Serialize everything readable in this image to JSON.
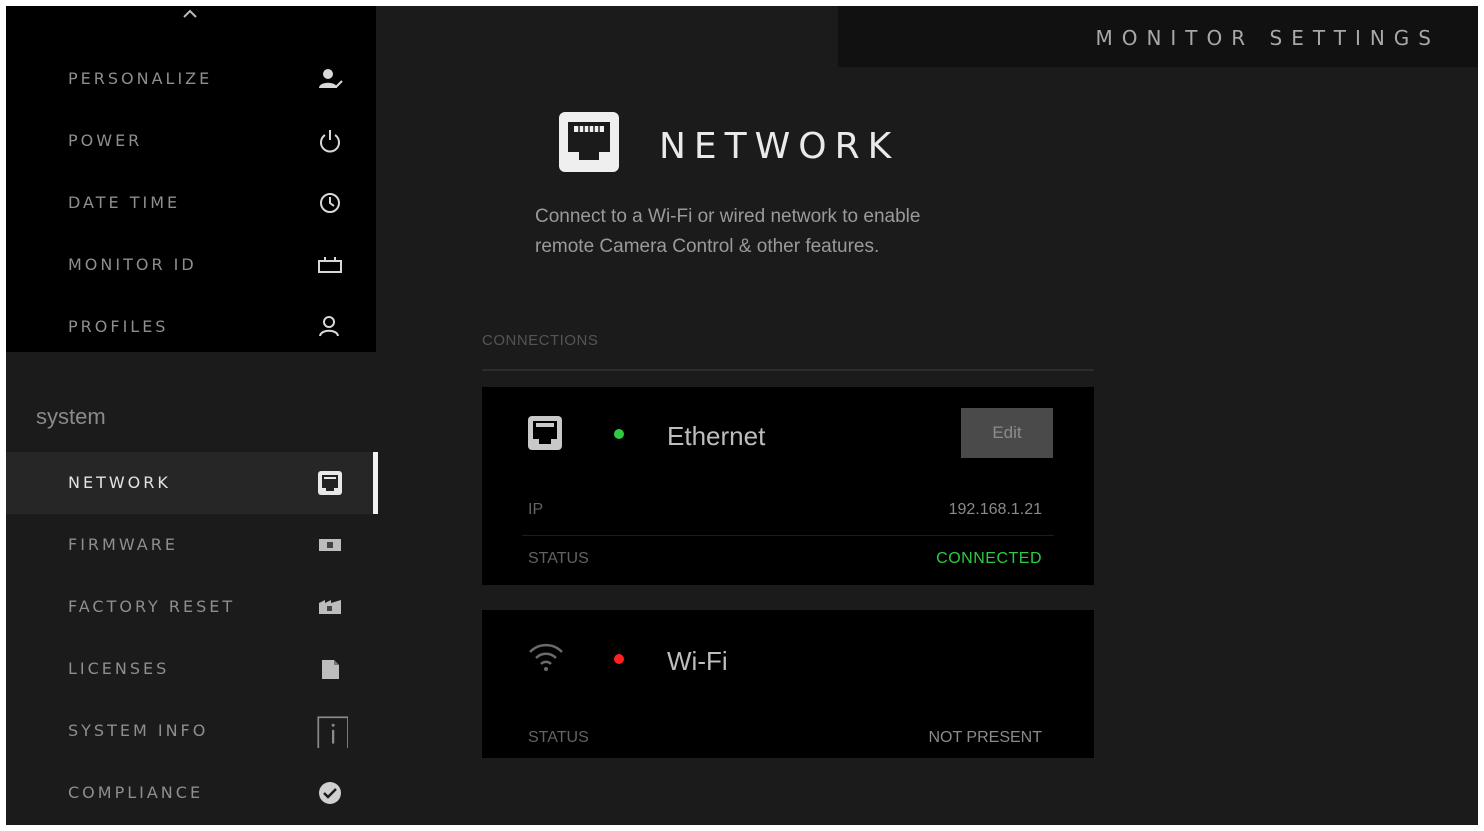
{
  "header": {
    "title": "MONITOR SETTINGS"
  },
  "sidebar": {
    "top_items": [
      {
        "label": "PERSONALIZE",
        "icon": "personalize-icon"
      },
      {
        "label": "POWER",
        "icon": "power-icon"
      },
      {
        "label": "DATE TIME",
        "icon": "clock-icon"
      },
      {
        "label": "MONITOR ID",
        "icon": "monitor-id-icon"
      },
      {
        "label": "PROFILES",
        "icon": "profiles-icon"
      }
    ],
    "section_label": "system",
    "system_items": [
      {
        "label": "NETWORK",
        "icon": "ethernet-port-icon",
        "active": true
      },
      {
        "label": "FIRMWARE",
        "icon": "firmware-icon"
      },
      {
        "label": "FACTORY RESET",
        "icon": "factory-reset-icon"
      },
      {
        "label": "LICENSES",
        "icon": "licenses-icon"
      },
      {
        "label": "SYSTEM INFO",
        "icon": "info-icon"
      },
      {
        "label": "COMPLIANCE",
        "icon": "check-circle-icon"
      }
    ]
  },
  "page": {
    "title": "NETWORK",
    "icon": "ethernet-port-icon",
    "description": "Connect to a Wi-Fi or wired network to enable remote Camera Control & other features."
  },
  "connections": {
    "label": "CONNECTIONS",
    "ethernet": {
      "name": "Ethernet",
      "icon": "ethernet-port-icon",
      "indicator_color": "#2ecc40",
      "edit_label": "Edit",
      "ip_label": "IP",
      "ip_value": "192.168.1.21",
      "status_label": "STATUS",
      "status_value": "CONNECTED",
      "status_color": "#2ecc40"
    },
    "wifi": {
      "name": "Wi-Fi",
      "icon": "wifi-icon",
      "indicator_color": "#ff2020",
      "status_label": "STATUS",
      "status_value": "NOT PRESENT"
    }
  },
  "colors": {
    "background": "#1b1b1b",
    "panel": "#000000",
    "accent": "#f2f2f2",
    "connected": "#2ecc40",
    "error": "#ff2020"
  }
}
